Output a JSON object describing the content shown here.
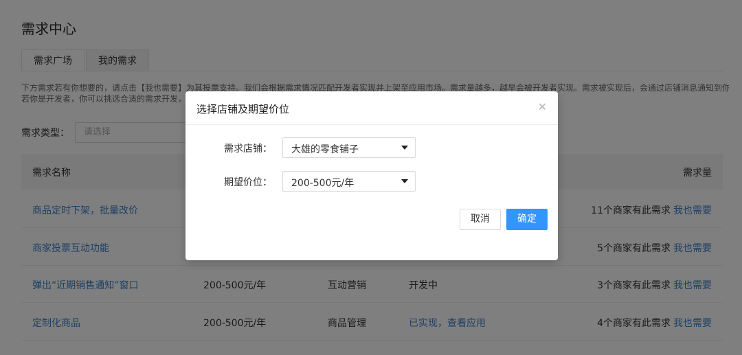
{
  "page": {
    "title": "需求中心",
    "tabs": [
      "需求广场",
      "我的需求"
    ],
    "notice": [
      "下方需求若有你想要的，请点击【我也需要】为其投票支持。我们会根据需求情况匹配开发者实现并上架至应用市场。需求量越多，越早会被开发者实现。需求被实现后，会通过店铺消息通知到你。",
      "若你是开发者，你可以挑选合适的需求开发，由"
    ],
    "filter": {
      "label": "需求类型：",
      "placeholder": "请选择"
    },
    "table": {
      "headers": {
        "name": "需求名称",
        "count": "需求量"
      },
      "action_label": "我也需要",
      "rows": [
        {
          "name": "商品定时下架，批量改价",
          "price": "",
          "category": "",
          "status": "",
          "count": "11个商家有此需求"
        },
        {
          "name": "商家投票互动功能",
          "price": "",
          "category": "",
          "status": "",
          "count": "5个商家有此需求"
        },
        {
          "name": "弹出“近期销售通知”窗口",
          "price": "200-500元/年",
          "category": "互动营销",
          "status": "开发中",
          "count": "3个商家有此需求"
        },
        {
          "name": "定制化商品",
          "price": "200-500元/年",
          "category": "商品管理",
          "status": "已实现，查看应用",
          "count": "4个商家有此需求"
        }
      ]
    }
  },
  "modal": {
    "title": "选择店铺及期望价位",
    "close_icon": "close-icon",
    "store": {
      "label": "需求店铺：",
      "value": "大雄的零食铺子"
    },
    "price": {
      "label": "期望价位：",
      "value": "200-500元/年"
    },
    "cancel_label": "取消",
    "ok_label": "确定"
  },
  "colors": {
    "link": "#3a7ec8",
    "primary": "#3396ff",
    "overlay": "rgba(0,0,0,0.5)"
  }
}
